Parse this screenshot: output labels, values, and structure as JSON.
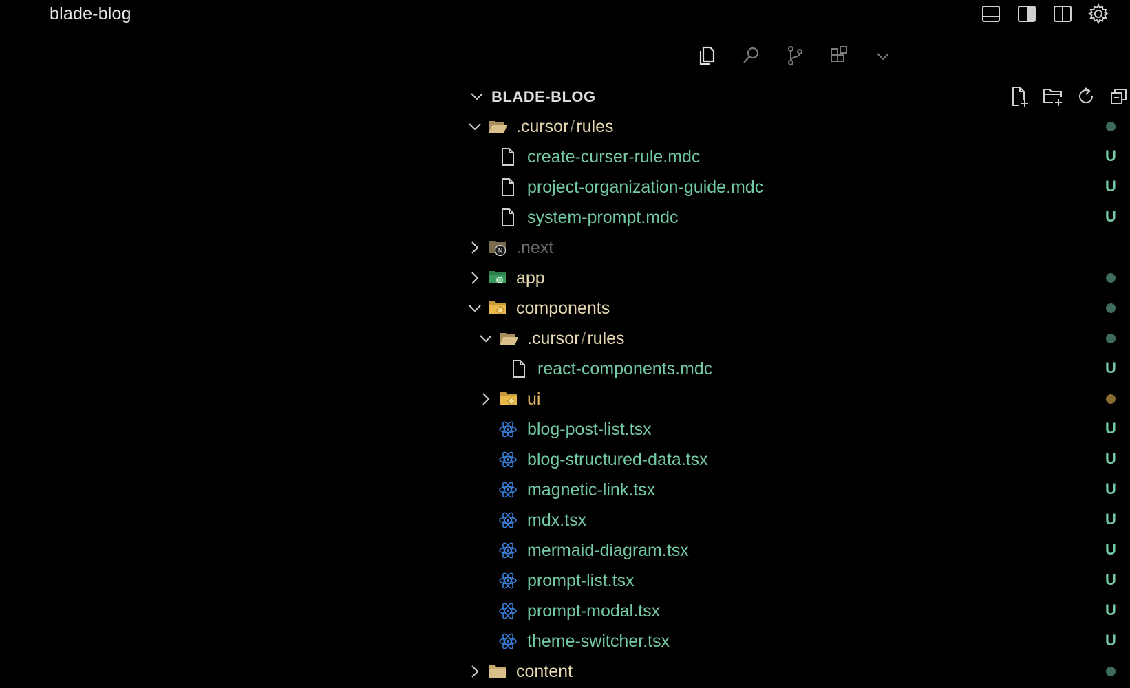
{
  "window": {
    "title": "blade-blog"
  },
  "layout_controls": [
    "panel-toggle-icon",
    "secondary-sidebar-toggle-icon",
    "split-editor-icon",
    "gear-icon"
  ],
  "activity_bar": [
    "explorer-icon",
    "search-icon",
    "source-control-icon",
    "extensions-icon",
    "chevron-down-icon"
  ],
  "explorer": {
    "root": "BLADE-BLOG",
    "actions": [
      "new-file-icon",
      "new-folder-icon",
      "refresh-icon",
      "collapse-all-icon"
    ]
  },
  "colors": {
    "untracked": "#73c9a3",
    "folder": "#e6d8b0",
    "ignored": "#6b6b6b",
    "modified": "#e5b567",
    "dot_green": "#3e6b5c",
    "dot_orange": "#8a6a2e",
    "react": "#3b7fd9"
  },
  "tree": [
    {
      "depth": 0,
      "type": "folder",
      "open": true,
      "icon": "folder-open-icon",
      "parts": [
        ".cursor",
        "rules"
      ],
      "color": "folder",
      "status": "dot",
      "status_color": "dot_green"
    },
    {
      "depth": 1,
      "type": "file",
      "icon": "file-icon",
      "name": "create-curser-rule.mdc",
      "color": "untracked",
      "status": "U"
    },
    {
      "depth": 1,
      "type": "file",
      "icon": "file-icon",
      "name": "project-organization-guide.mdc",
      "color": "untracked",
      "status": "U"
    },
    {
      "depth": 1,
      "type": "file",
      "icon": "file-icon",
      "name": "system-prompt.mdc",
      "color": "untracked",
      "status": "U"
    },
    {
      "depth": 0,
      "type": "folder",
      "open": false,
      "icon": "next-folder-icon",
      "name": ".next",
      "color": "ignored",
      "status": ""
    },
    {
      "depth": 0,
      "type": "folder",
      "open": false,
      "icon": "app-folder-icon",
      "name": "app",
      "color": "folder",
      "status": "dot",
      "status_color": "dot_green"
    },
    {
      "depth": 0,
      "type": "folder",
      "open": true,
      "icon": "components-folder-icon",
      "name": "components",
      "color": "folder",
      "status": "dot",
      "status_color": "dot_green"
    },
    {
      "depth": 1,
      "type": "folder",
      "open": true,
      "icon": "folder-open-icon",
      "parts": [
        ".cursor",
        "rules"
      ],
      "color": "folder",
      "status": "dot",
      "status_color": "dot_green"
    },
    {
      "depth": 2,
      "type": "file",
      "icon": "file-icon",
      "name": "react-components.mdc",
      "color": "untracked",
      "status": "U"
    },
    {
      "depth": 1,
      "type": "folder",
      "open": false,
      "icon": "components-folder-icon",
      "name": "ui",
      "color": "modified",
      "status": "dot",
      "status_color": "dot_orange"
    },
    {
      "depth": 1,
      "type": "file",
      "icon": "react-icon",
      "name": "blog-post-list.tsx",
      "color": "untracked",
      "status": "U"
    },
    {
      "depth": 1,
      "type": "file",
      "icon": "react-icon",
      "name": "blog-structured-data.tsx",
      "color": "untracked",
      "status": "U"
    },
    {
      "depth": 1,
      "type": "file",
      "icon": "react-icon",
      "name": "magnetic-link.tsx",
      "color": "untracked",
      "status": "U"
    },
    {
      "depth": 1,
      "type": "file",
      "icon": "react-icon",
      "name": "mdx.tsx",
      "color": "untracked",
      "status": "U"
    },
    {
      "depth": 1,
      "type": "file",
      "icon": "react-icon",
      "name": "mermaid-diagram.tsx",
      "color": "untracked",
      "status": "U"
    },
    {
      "depth": 1,
      "type": "file",
      "icon": "react-icon",
      "name": "prompt-list.tsx",
      "color": "untracked",
      "status": "U"
    },
    {
      "depth": 1,
      "type": "file",
      "icon": "react-icon",
      "name": "prompt-modal.tsx",
      "color": "untracked",
      "status": "U"
    },
    {
      "depth": 1,
      "type": "file",
      "icon": "react-icon",
      "name": "theme-switcher.tsx",
      "color": "untracked",
      "status": "U"
    },
    {
      "depth": 0,
      "type": "folder",
      "open": false,
      "icon": "folder-icon",
      "name": "content",
      "color": "folder",
      "status": "dot",
      "status_color": "dot_green"
    }
  ]
}
